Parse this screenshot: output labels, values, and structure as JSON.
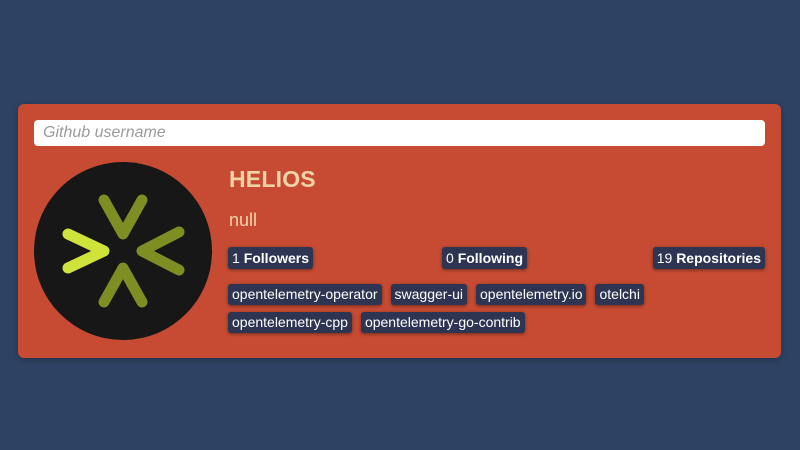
{
  "search": {
    "placeholder": "Github username",
    "value": ""
  },
  "profile": {
    "avatar_icon": "opentelemetry-logo-icon",
    "name": "HELIOS",
    "bio": "null"
  },
  "stats": {
    "followers": {
      "count": "1",
      "label": "Followers"
    },
    "following": {
      "count": "0",
      "label": "Following"
    },
    "repositories": {
      "count": "19",
      "label": "Repositories"
    }
  },
  "repos": [
    "opentelemetry-operator",
    "swagger-ui",
    "opentelemetry.io",
    "otelchi",
    "opentelemetry-cpp",
    "opentelemetry-go-contrib"
  ],
  "colors": {
    "background": "#2e4263",
    "card": "#c64b32",
    "badge": "#2e3552",
    "text_accent": "#f2d3a8"
  }
}
